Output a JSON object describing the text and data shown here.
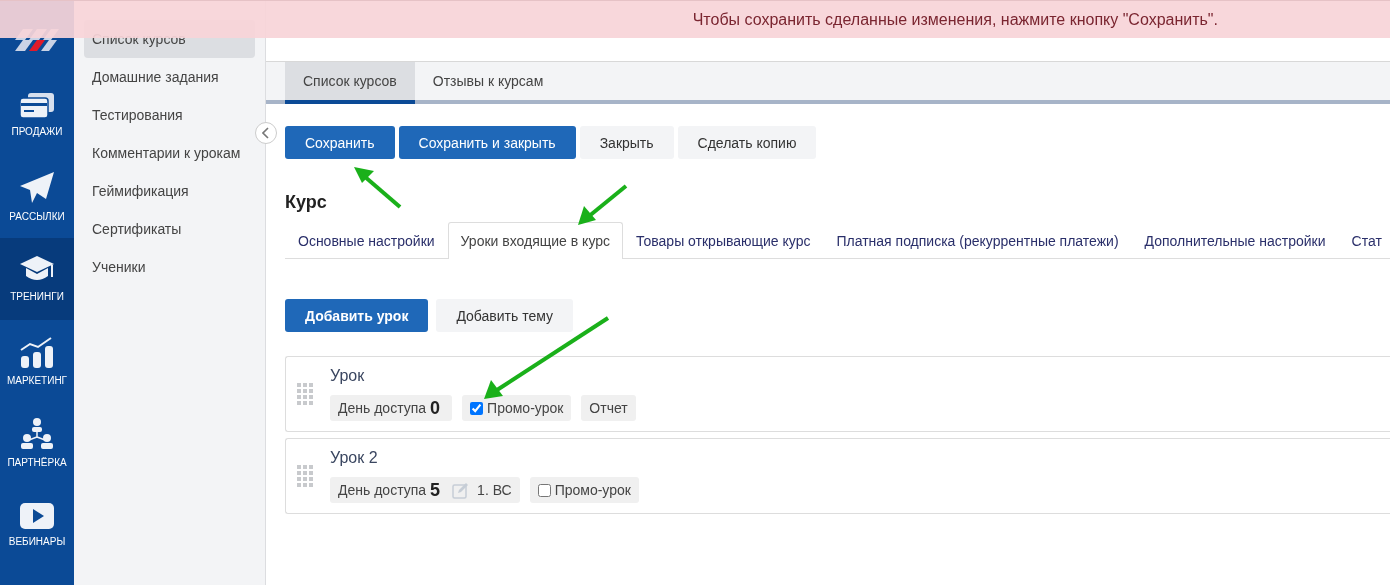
{
  "banner": {
    "message": "Чтобы сохранить сделанные изменения, нажмите кнопку \"Сохранить\"."
  },
  "nav": [
    {
      "label": "ПРОДАЖИ",
      "kind": "card",
      "selected": false
    },
    {
      "label": "РАССЫЛКИ",
      "kind": "plane",
      "selected": false
    },
    {
      "label": "ТРЕНИНГИ",
      "kind": "cap",
      "selected": true
    },
    {
      "label": "МАРКЕТИНГ",
      "kind": "chart",
      "selected": false
    },
    {
      "label": "ПАРТНЁРКА",
      "kind": "people",
      "selected": false
    },
    {
      "label": "ВЕБИНАРЫ",
      "kind": "play",
      "selected": false
    }
  ],
  "sidebar": {
    "items": [
      {
        "label": "Список курсов",
        "selected": true
      },
      {
        "label": "Домашние задания",
        "selected": false
      },
      {
        "label": "Тестирования",
        "selected": false
      },
      {
        "label": "Комментарии к урокам",
        "selected": false
      },
      {
        "label": "Геймификация",
        "selected": false
      },
      {
        "label": "Сертификаты",
        "selected": false
      },
      {
        "label": "Ученики",
        "selected": false
      }
    ]
  },
  "page_tabs": [
    {
      "label": "Список курсов",
      "selected": true
    },
    {
      "label": "Отзывы к курсам",
      "selected": false
    }
  ],
  "actions": [
    {
      "label": "Сохранить",
      "kind": "primary"
    },
    {
      "label": "Сохранить и закрыть",
      "kind": "primary"
    },
    {
      "label": "Закрыть",
      "kind": "secondary"
    },
    {
      "label": "Сделать копию",
      "kind": "secondary"
    }
  ],
  "course": {
    "title": "Курс",
    "tabs": [
      {
        "label": "Основные настройки",
        "selected": false
      },
      {
        "label": "Уроки входящие в курс",
        "selected": true
      },
      {
        "label": "Товары открывающие курс",
        "selected": false
      },
      {
        "label": "Платная подписка (рекуррентные платежи)",
        "selected": false
      },
      {
        "label": "Дополнительные настройки",
        "selected": false
      },
      {
        "label": "Стат",
        "selected": false
      }
    ],
    "lesson_actions": [
      {
        "label": "Добавить урок",
        "kind": "primary"
      },
      {
        "label": "Добавить тему",
        "kind": "secondary"
      }
    ],
    "lessons": [
      {
        "title": "Урок",
        "chips": [
          {
            "kind": "day",
            "label": "День доступа",
            "value": "0"
          },
          {
            "kind": "promo",
            "label": "Промо-урок",
            "checked": true
          },
          {
            "kind": "report",
            "label": "Отчет"
          }
        ]
      },
      {
        "title": "Урок 2",
        "chips": [
          {
            "kind": "day",
            "label": "День доступа",
            "value": "5",
            "note": "1. ВС"
          },
          {
            "kind": "promo",
            "label": "Промо-урок",
            "checked": false
          }
        ]
      }
    ]
  }
}
